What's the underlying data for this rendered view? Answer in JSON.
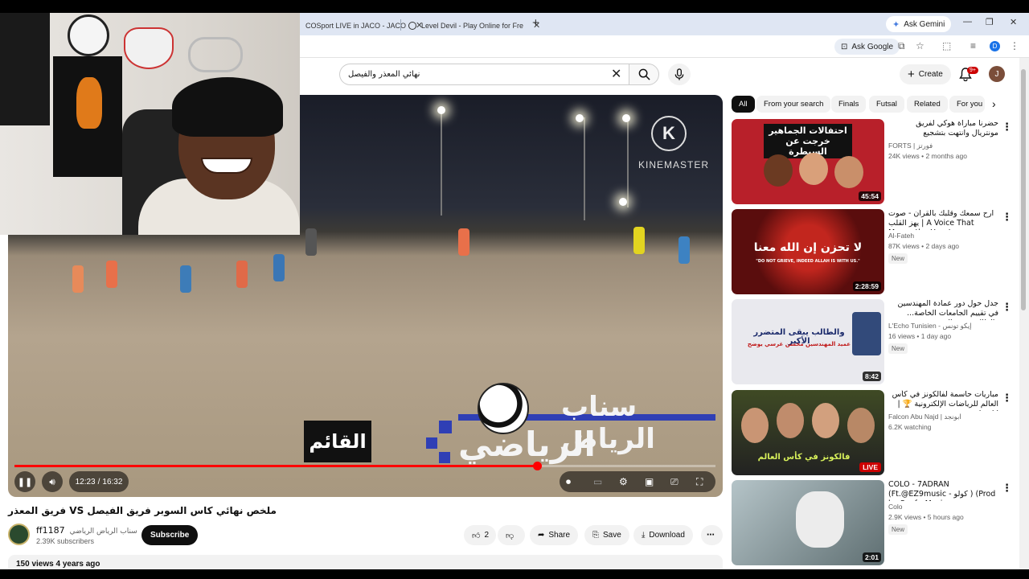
{
  "browser": {
    "tabs": [
      {
        "label": "COSport LIVE in JACO - JACO"
      },
      {
        "label": "Level Devil - Play Online for Fre"
      }
    ],
    "ask_gemini": "Ask Gemini",
    "ask_google": "Ask Google",
    "profile_letter": "D"
  },
  "header": {
    "search_value": "نهائي المعذر والفيصل",
    "create_label": "Create",
    "notif_count": "9+",
    "avatar_letter": "J"
  },
  "player": {
    "time_current": "12:23",
    "time_sep": "/",
    "time_total": "16:32",
    "progress_fraction": 0.745,
    "overlay_label": "القائم",
    "overlay_title_1": "سناب الرياض",
    "overlay_title_2": "الرياضي",
    "watermark": "KINEMASTER",
    "watermark_letter": "K"
  },
  "video": {
    "title": "فريق المعذر VS ملخص نهائي كاس السوبر فريق الفيصل",
    "channel_name": "ff1187",
    "channel_name_ar": "سناب الرياض الرياضي",
    "subscribers": "2.39K subscribers",
    "subscribe_label": "Subscribe",
    "like_count": "2",
    "share_label": "Share",
    "save_label": "Save",
    "download_label": "Download",
    "views_meta": "150 views  4 years ago"
  },
  "chips": [
    {
      "label": "All",
      "active": true
    },
    {
      "label": "From your search"
    },
    {
      "label": "Finals"
    },
    {
      "label": "Futsal"
    },
    {
      "label": "Related"
    },
    {
      "label": "For you"
    }
  ],
  "recommendations": [
    {
      "title": "حضرنا مباراة هوكي لفريق مونتريال وانتهت بتشجيع",
      "channel": "FORTS | فورتز",
      "meta": "24K views • 2 months ago",
      "duration": "45:54",
      "thumb_text": "احتفالات الجماهير خرجت عن السيطرة",
      "thumb_color": "#b8202a"
    },
    {
      "title": "ارح سمعك وقلبك بالقرآن - صوت يهز القلب | A Voice That Moves the Heart ...",
      "channel": "Al-Fateh",
      "meta": "87K views • 2 days ago",
      "badge": "New",
      "duration": "2:28:59",
      "thumb_text": "لا تحزن إن الله معنا",
      "thumb_sub": "\"DO NOT GRIEVE, INDEED ALLAH IS WITH US.\"",
      "thumb_color": "#5a0d0d"
    },
    {
      "title": "جدل حول دور عمادة المهندسين في تقييم الجامعات الخاصة... والطالب يبقى المتضرر",
      "channel": "L'Echo Tunisien - إيكو تونس",
      "meta": "16 views • 1 day ago",
      "badge": "New",
      "duration": "8:42",
      "thumb_text": "والطالب يبقى المتضرر الأكبر",
      "thumb_sub": "عميد المهندسين محسن غرسي يوضح",
      "thumb_color": "#e9e9ee"
    },
    {
      "title": "مباريات حاسمة لفالكونز في كأس العالم للرياضات الإلكترونية 🏆 | إيك هاشر",
      "channel": "Falcon Abu Najd | ابونجد",
      "meta": "6.2K watching",
      "live": "LIVE",
      "thumb_text": "فالكونز في كأس العالم",
      "thumb_color": "#2f3a20"
    },
    {
      "title": "COLO - 7ADRAN (Ft.@EZ9music - كولو ) (Prod by SanforMusic ...",
      "channel": "Colo",
      "meta": "2.9K views • 5 hours ago",
      "badge": "New",
      "duration": "2:01",
      "thumb_color": "#8a9aa0"
    }
  ]
}
